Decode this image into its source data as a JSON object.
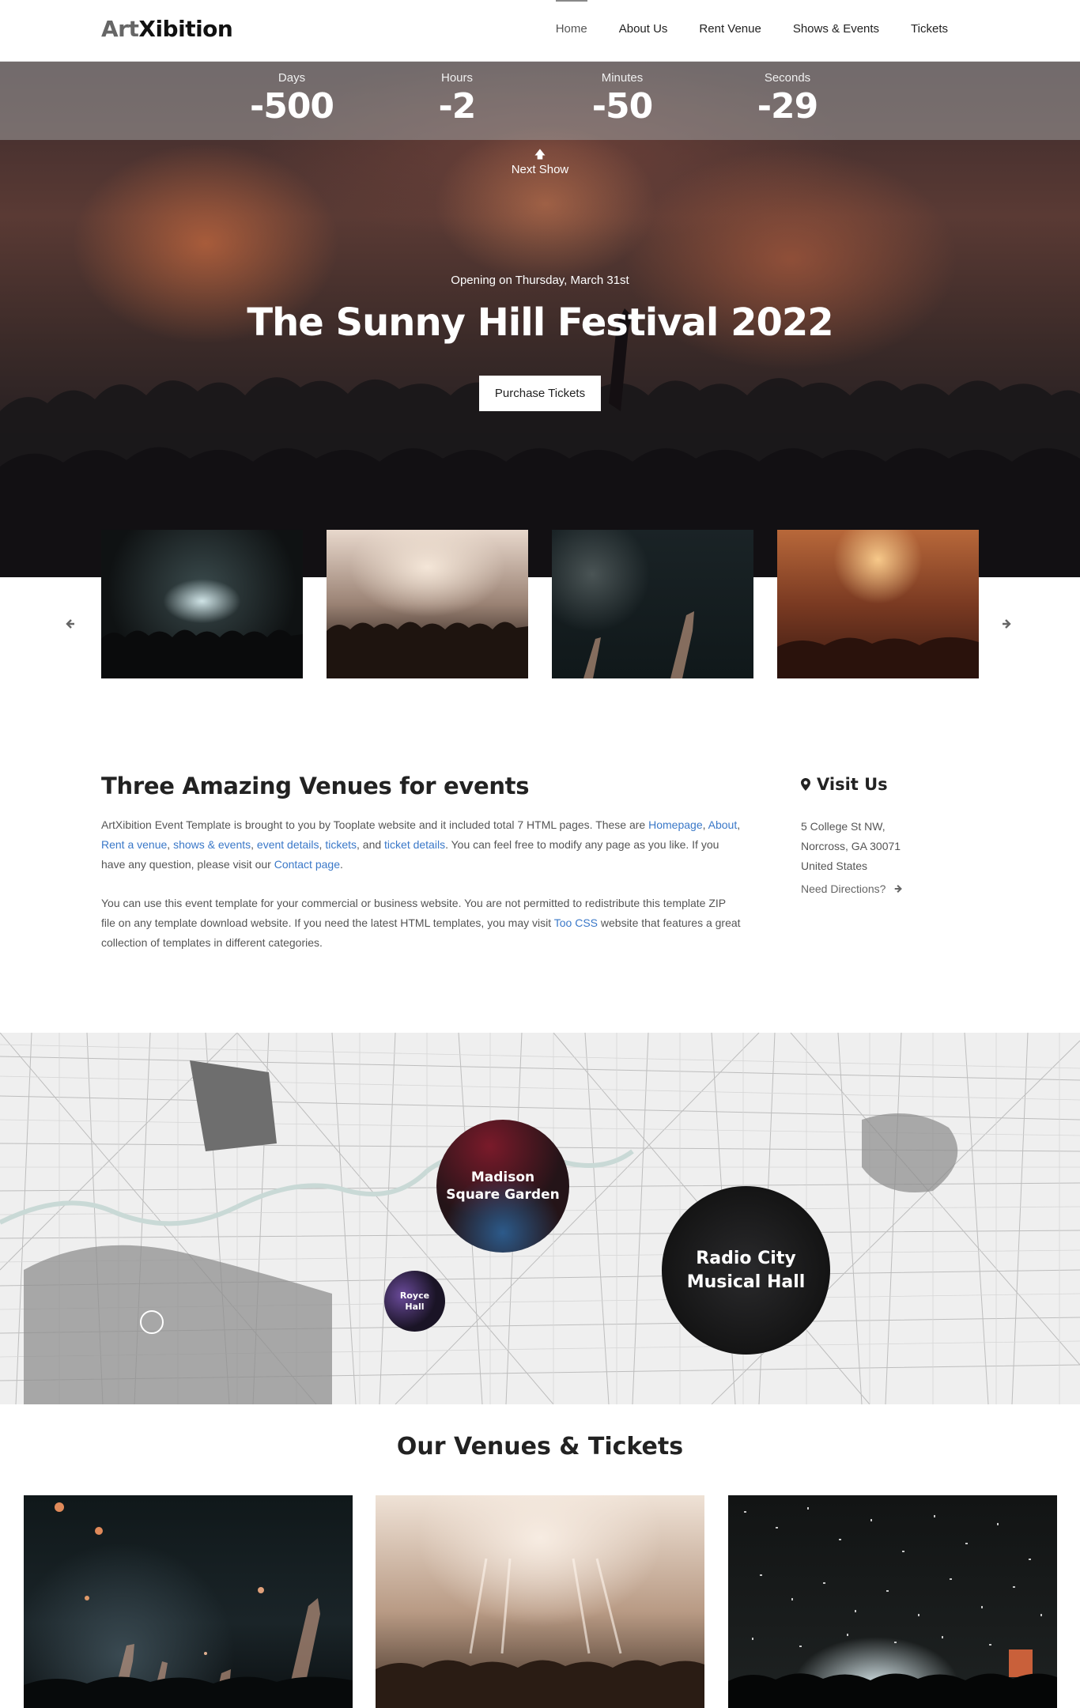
{
  "nav": {
    "logo_part1": "Art",
    "logo_part2": "Xibition",
    "items": [
      {
        "label": "Home",
        "active": true
      },
      {
        "label": "About Us"
      },
      {
        "label": "Rent Venue"
      },
      {
        "label": "Shows & Events"
      },
      {
        "label": "Tickets"
      }
    ]
  },
  "countdown": [
    {
      "label": "Days",
      "value": "-500"
    },
    {
      "label": "Hours",
      "value": "-2"
    },
    {
      "label": "Minutes",
      "value": "-50"
    },
    {
      "label": "Seconds",
      "value": "-29"
    }
  ],
  "hero": {
    "next_show": "Next Show",
    "opening": "Opening on Thursday, March 31st",
    "title": "The Sunny Hill Festival 2022",
    "button": "Purchase Tickets"
  },
  "carousel": {
    "prev_icon": "arrow-left-icon",
    "next_icon": "arrow-right-icon"
  },
  "about": {
    "title": "Three Amazing Venues for events",
    "p1_start": "ArtXibition Event Template is brought to you by Tooplate website and it included total 7 HTML pages. These are ",
    "p1_links": [
      "Homepage",
      "About",
      "Rent a venue",
      "shows & events",
      "event details",
      "tickets"
    ],
    "p1_and": ", and ",
    "p1_link_last": "ticket details",
    "p1_mid": ". You can feel free to modify any page as you like. If you have any question, please visit our ",
    "p1_link_contact": "Contact page",
    "p1_end": ".",
    "p2_start": "You can use this event template for your commercial or business website. You are not permitted to redistribute this template ZIP file on any template download website. If you need the latest HTML templates, you may visit ",
    "p2_link": "Too CSS",
    "p2_end": " website that features a great collection of templates in different categories."
  },
  "visit": {
    "title": "Visit Us",
    "address_line1": "5 College St NW,",
    "address_line2": "Norcross, GA 30071",
    "address_line3": "United States",
    "directions": "Need Directions?"
  },
  "map_venues": [
    {
      "name_line1": "Madison",
      "name_line2": "Square Garden"
    },
    {
      "name_line1": "Radio City",
      "name_line2": "Musical Hall"
    },
    {
      "name_line1": "Royce",
      "name_line2": "Hall"
    }
  ],
  "venues_tickets": {
    "title": "Our Venues & Tickets"
  }
}
